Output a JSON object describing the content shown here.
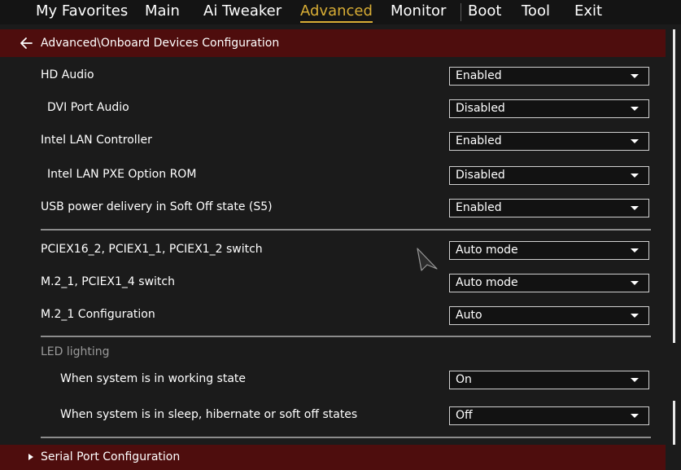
{
  "menu": {
    "tabs": [
      {
        "label": "My Favorites"
      },
      {
        "label": "Main"
      },
      {
        "label": "Ai Tweaker"
      },
      {
        "label": "Advanced"
      },
      {
        "label": "Monitor"
      },
      {
        "label": "Boot"
      },
      {
        "label": "Tool"
      },
      {
        "label": "Exit"
      }
    ],
    "active_tab": "Advanced"
  },
  "breadcrumb": {
    "path": "Advanced\\Onboard Devices Configuration",
    "back_icon": "arrow-left-icon"
  },
  "settings": [
    {
      "label": "HD Audio",
      "value": "Enabled"
    },
    {
      "label": "DVI Port Audio",
      "value": "Disabled"
    },
    {
      "label": "Intel LAN Controller",
      "value": "Enabled"
    },
    {
      "label": "Intel LAN PXE Option ROM",
      "value": "Disabled"
    },
    {
      "label": "USB power delivery in Soft Off state (S5)",
      "value": "Enabled"
    },
    {
      "label": "PCIEX16_2, PCIEX1_1, PCIEX1_2 switch",
      "value": "Auto mode"
    },
    {
      "label": "M.2_1, PCIEX1_4 switch",
      "value": "Auto mode"
    },
    {
      "label": "M.2_1 Configuration",
      "value": "Auto"
    }
  ],
  "led_section": {
    "title": "LED lighting",
    "items": [
      {
        "label": "When system is in working state",
        "value": "On"
      },
      {
        "label": "When system is in sleep, hibernate or soft off states",
        "value": "Off"
      }
    ]
  },
  "submenu": {
    "label": "Serial Port Configuration",
    "icon": "chevron-right-icon"
  },
  "colors": {
    "accent": "#d8ad35",
    "header_bar": "#4e0d0d",
    "background": "#1b1b1b"
  }
}
